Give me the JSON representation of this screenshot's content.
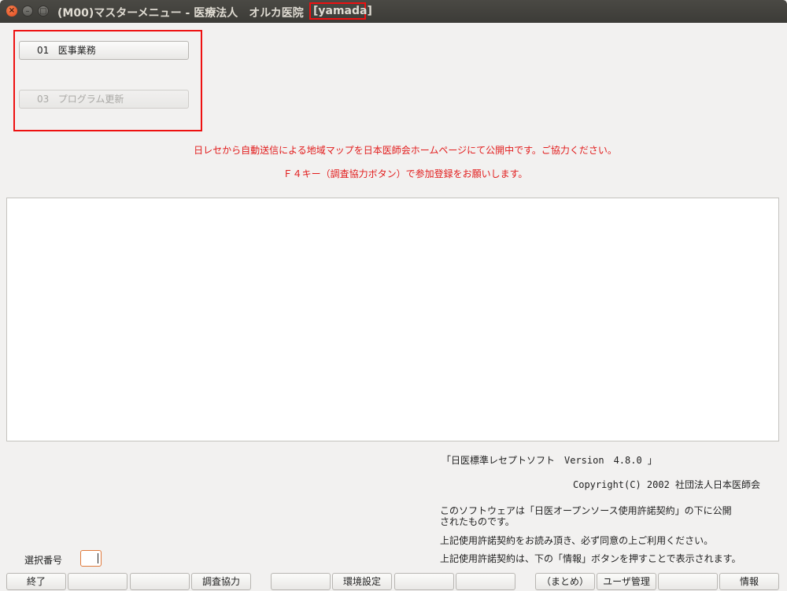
{
  "window": {
    "title": "(M00)マスターメニュー - 医療法人　オルカ医院",
    "user": "[yamada]"
  },
  "menu": {
    "items": [
      {
        "number": "01",
        "label": "医事業務",
        "enabled": true
      },
      {
        "number": "03",
        "label": "プログラム更新",
        "enabled": false
      }
    ]
  },
  "notice": {
    "line1": "日レセから自動送信による地域マップを日本医師会ホームページにて公開中です。ご協力ください。",
    "line2": "Ｆ４キー（調査協力ボタン）で参加登録をお願いします。"
  },
  "info": {
    "version": "「日医標準レセプトソフト　Version　4.8.0 」",
    "copyright": "Copyright(C) 2002 社団法人日本医師会",
    "license1": "このソフトウェアは「日医オープンソース使用許諾契約」の下に公開",
    "license2": "されたものです。",
    "license3": "上記使用許諾契約をお読み頂き、必ず同意の上ご利用ください。",
    "license4": "上記使用許諾契約は、下の「情報」ボタンを押すことで表示されます。"
  },
  "selection": {
    "label": "選択番号",
    "value": ""
  },
  "fkeys": [
    "終了",
    "",
    "",
    "調査協力",
    "",
    "環境設定",
    "",
    "",
    "（まとめ）",
    "ユーザ管理",
    "",
    "情報"
  ]
}
